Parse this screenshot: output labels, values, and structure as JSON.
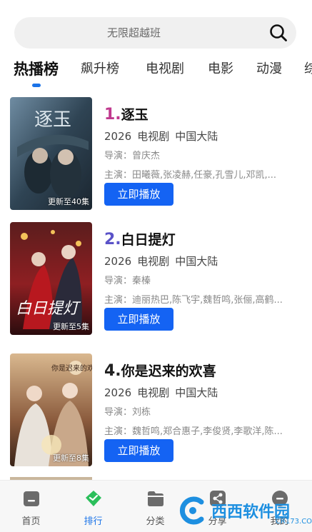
{
  "search": {
    "placeholder": "无限超越班"
  },
  "tabs": [
    {
      "label": "热播榜",
      "active": true
    },
    {
      "label": "飙升榜"
    },
    {
      "label": "电视剧"
    },
    {
      "label": "电影"
    },
    {
      "label": "动漫"
    },
    {
      "label": "综"
    }
  ],
  "items": [
    {
      "rank": "1.",
      "rank_color": "#c0398e",
      "title": "逐玉",
      "year": "2026",
      "type": "电视剧",
      "region": "中国大陆",
      "director": "导演：曾庆杰",
      "cast": "主演：田曦薇,张凌赫,任豪,孔雪儿,邓凯,...",
      "update": "更新至40集",
      "play_label": "立即播放",
      "poster_title": "逐玉"
    },
    {
      "rank": "2.",
      "rank_color": "#5a52c8",
      "title": "白日提灯",
      "year": "2026",
      "type": "电视剧",
      "region": "中国大陆",
      "director": "导演：秦榛",
      "cast": "主演：迪丽热巴,陈飞宇,魏哲鸣,张俪,高鹤...",
      "update": "更新至5集",
      "play_label": "立即播放",
      "poster_title": "白日提灯"
    },
    {
      "rank": "4.",
      "rank_color": "#222222",
      "title": "你是迟来的欢喜",
      "year": "2026",
      "type": "电视剧",
      "region": "中国大陆",
      "director": "导演：刘栋",
      "cast": "主演：魏哲鸣,郑合惠子,李俊贤,李歌洋,陈...",
      "update": "更新至8集",
      "play_label": "立即播放",
      "poster_title": "你是迟来的欢喜"
    }
  ],
  "bottom_nav": [
    {
      "label": "首页",
      "icon": "home-icon"
    },
    {
      "label": "排行",
      "icon": "diamond-icon",
      "active": true
    },
    {
      "label": "分类",
      "icon": "folder-icon"
    },
    {
      "label": "分享",
      "icon": "share-icon"
    },
    {
      "label": "我的",
      "icon": "profile-icon"
    }
  ],
  "watermark": {
    "text": "西西软件园",
    "sub": "CR173.COM"
  },
  "colors": {
    "accent": "#1a73e8",
    "play_button": "#1463f3"
  }
}
